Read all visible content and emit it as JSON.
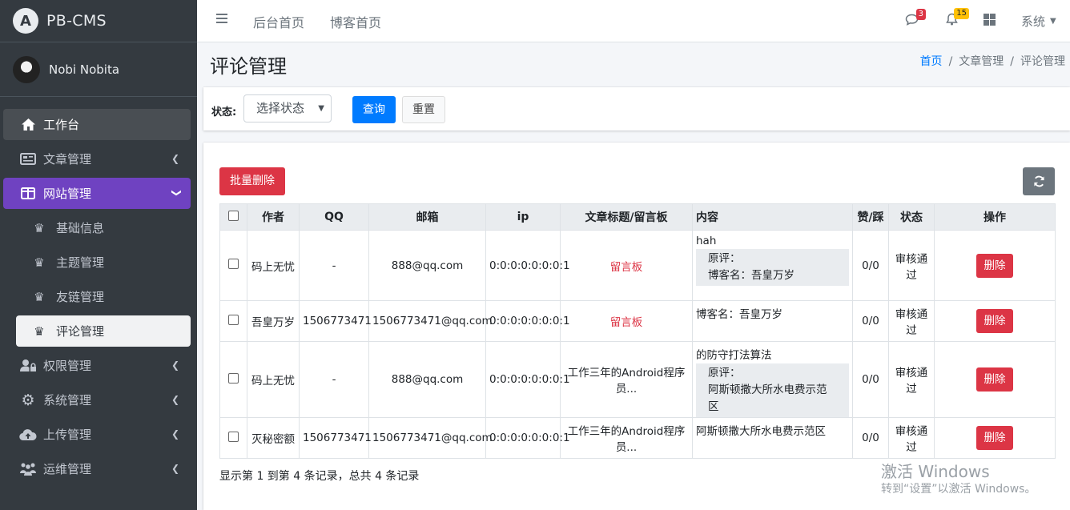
{
  "brand": {
    "name": "PB-CMS"
  },
  "user": {
    "name": "Nobi Nobita"
  },
  "sidebar": {
    "items": [
      {
        "label": "工作台",
        "icon": "home-icon"
      },
      {
        "label": "文章管理",
        "icon": "newspaper-icon"
      },
      {
        "label": "网站管理",
        "icon": "window-icon"
      },
      {
        "label": "权限管理",
        "icon": "user-lock-icon"
      },
      {
        "label": "系统管理",
        "icon": "gear-icon"
      },
      {
        "label": "上传管理",
        "icon": "cloud-upload-icon"
      },
      {
        "label": "运维管理",
        "icon": "people-icon"
      }
    ],
    "sub_items": [
      {
        "label": "基础信息",
        "icon": "chess-queen-icon"
      },
      {
        "label": "主题管理",
        "icon": "chess-queen-icon"
      },
      {
        "label": "友链管理",
        "icon": "chess-queen-icon"
      },
      {
        "label": "评论管理",
        "icon": "chess-queen-icon"
      }
    ]
  },
  "topbar": {
    "links": [
      "后台首页",
      "博客首页"
    ],
    "message_count": "3",
    "notification_count": "15",
    "system_label": "系统"
  },
  "page": {
    "title": "评论管理",
    "breadcrumb": [
      "首页",
      "文章管理",
      "评论管理"
    ]
  },
  "filter": {
    "status_label": "状态:",
    "status_select": "选择状态",
    "query_label": "查询",
    "reset_label": "重置"
  },
  "toolbar": {
    "batch_delete_label": "批量删除"
  },
  "table": {
    "headers": [
      "作者",
      "QQ",
      "邮箱",
      "ip",
      "文章标题/留言板",
      "内容",
      "赞/踩",
      "状态",
      "操作"
    ],
    "rows": [
      {
        "author": "码上无忧",
        "qq": "-",
        "email": "888@qq.com",
        "ip": "0:0:0:0:0:0:0:1",
        "title": "留言板",
        "content": "hah",
        "quote_lines": [
          "原评：",
          "博客名：吾皇万岁"
        ],
        "votes": "0/0",
        "status": "审核通过",
        "action": "删除"
      },
      {
        "author": "吾皇万岁",
        "qq": "1506773471",
        "email": "1506773471@qq.com",
        "ip": "0:0:0:0:0:0:0:1",
        "title": "留言板",
        "content": "博客名：吾皇万岁",
        "quote_lines": [],
        "votes": "0/0",
        "status": "审核通过",
        "action": "删除"
      },
      {
        "author": "码上无忧",
        "qq": "-",
        "email": "888@qq.com",
        "ip": "0:0:0:0:0:0:0:1",
        "title": "工作三年的Android程序员...",
        "content": "的防守打法算法",
        "quote_lines": [
          "原评：",
          "阿斯顿撒大所水电费示范区"
        ],
        "votes": "0/0",
        "status": "审核通过",
        "action": "删除"
      },
      {
        "author": "灭秘密额",
        "qq": "1506773471",
        "email": "1506773471@qq.com",
        "ip": "0:0:0:0:0:0:0:1",
        "title": "工作三年的Android程序员...",
        "content": "阿斯顿撒大所水电费示范区",
        "quote_lines": [],
        "votes": "0/0",
        "status": "审核通过",
        "action": "删除"
      }
    ],
    "summary": "显示第 1 到第 4 条记录，总共 4 条记录"
  },
  "watermark": {
    "line1": "激活 Windows",
    "line2": "转到“设置”以激活 Windows。"
  },
  "colors": {
    "sidebar_bg": "#343a40",
    "active_purple": "#6f42c1",
    "primary": "#007bff",
    "danger": "#dc3545"
  }
}
